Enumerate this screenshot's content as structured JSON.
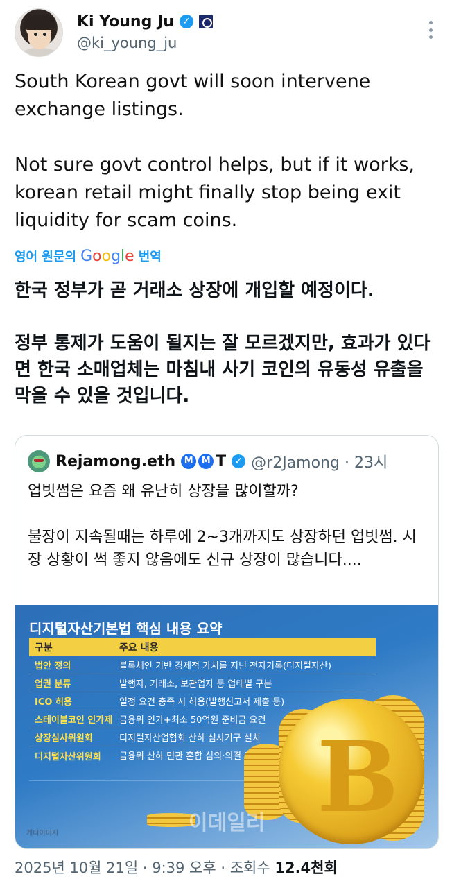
{
  "author": {
    "name": "Ki Young Ju",
    "handle": "@ki_young_ju"
  },
  "tweet": {
    "paragraph_1": "South Korean govt will soon intervene exchange listings.",
    "paragraph_2": "Not sure govt control helps, but if it works, korean retail might finally stop being exit liquidity for scam coins."
  },
  "translate": {
    "prefix": "영어 원문의",
    "google": [
      "G",
      "o",
      "o",
      "g",
      "l",
      "e"
    ],
    "suffix": "번역"
  },
  "translation": {
    "paragraph_1": "한국 정부가 곧 거래소 상장에 개입할 예정이다.",
    "paragraph_2": "정부 통제가 도움이 될지는 잘 모르겠지만, 효과가 있다면 한국 소매업체는 마침내 사기 코인의 유동성 유출을 막을 수 있을 것입니다."
  },
  "quote": {
    "name": "Rejamong.eth",
    "emoji_1": "M",
    "emoji_2": "M",
    "t_letter": "T",
    "handle_time": "@r2Jamong · 23시",
    "paragraph_1": "업빗썸은 요즘 왜 유난히 상장을 많이할까?",
    "paragraph_2": "불장이 지속될때는 하루에 2~3개까지도 상장하던 업빗썸. 시장 상황이 썩 좋지 않음에도 신규 상장이 많습니다...."
  },
  "image": {
    "title": "디지털자산기본법 핵심 내용 요약",
    "header_col1": "구분",
    "header_col2": "주요 내용",
    "rows": [
      {
        "c1": "법안 정의",
        "c2": "블록체인 기반 경제적 가치를 지닌 전자기록(디지털자산)"
      },
      {
        "c1": "업권 분류",
        "c2": "발행자, 거래소, 보관업자 등 업태별 구분"
      },
      {
        "c1": "ICO 허용",
        "c2": "일정 요건 충족 시 허용(발행신고서 제출 등)"
      },
      {
        "c1": "스테이블코인 인가제",
        "c2": "금융위 인가+최소 50억원 준비금 요건"
      },
      {
        "c1": "상장심사위원회",
        "c2": "디지털자산업협회 산하 심사기구 설치"
      },
      {
        "c1": "디지털자산위원회",
        "c2": "금융위 산하 민관 혼합 심의·의결 기구"
      }
    ],
    "credit": "게티이미지",
    "watermark": "이데일리"
  },
  "footer": {
    "date": "2025년 10월 21일 · 9:39 오후 · 조회수 ",
    "views": "12.4천회"
  }
}
